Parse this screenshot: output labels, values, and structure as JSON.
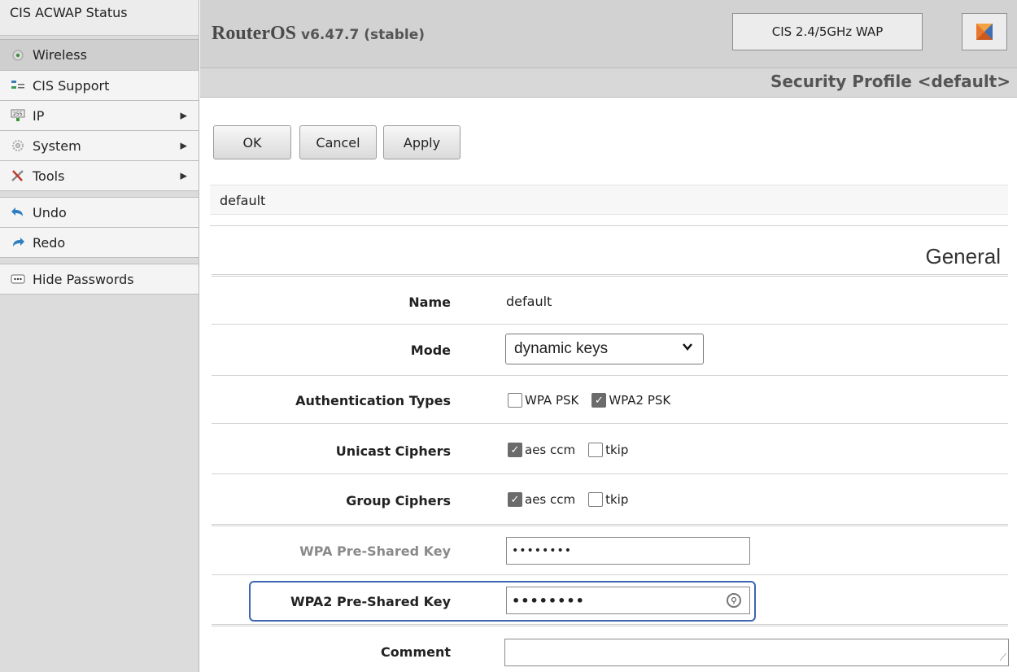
{
  "sidebar": {
    "title": "CIS ACWAP Status",
    "items": [
      {
        "label": "Wireless",
        "icon": "wireless-icon"
      },
      {
        "label": "CIS Support",
        "icon": "support-icon"
      },
      {
        "label": "IP",
        "icon": "ip-icon"
      },
      {
        "label": "System",
        "icon": "gear-icon"
      },
      {
        "label": "Tools",
        "icon": "tools-icon"
      },
      {
        "label": "Undo",
        "icon": "undo-icon"
      },
      {
        "label": "Redo",
        "icon": "redo-icon"
      },
      {
        "label": "Hide Passwords",
        "icon": "dots-icon"
      }
    ]
  },
  "header": {
    "product": "RouterOS",
    "version": "v6.47.7 (stable)",
    "device": "CIS 2.4/5GHz WAP",
    "page_title": "Security Profile <default>"
  },
  "toolbar": {
    "ok_label": "OK",
    "cancel_label": "Cancel",
    "apply_label": "Apply"
  },
  "profile_name_bar": "default",
  "section": "General",
  "form": {
    "name_label": "Name",
    "name_value": "default",
    "mode_label": "Mode",
    "mode_value": "dynamic keys",
    "auth_label": "Authentication Types",
    "auth_opts": [
      {
        "label": "WPA PSK",
        "checked": false
      },
      {
        "label": "WPA2 PSK",
        "checked": true
      }
    ],
    "unicast_label": "Unicast Ciphers",
    "unicast_opts": [
      {
        "label": "aes ccm",
        "checked": true
      },
      {
        "label": "tkip",
        "checked": false
      }
    ],
    "group_label": "Group Ciphers",
    "group_opts": [
      {
        "label": "aes ccm",
        "checked": true
      },
      {
        "label": "tkip",
        "checked": false
      }
    ],
    "wpa_psk_label": "WPA Pre-Shared Key",
    "wpa_psk_value": "••••••••",
    "wpa2_psk_label": "WPA2 Pre-Shared Key",
    "wpa2_psk_value": "••••••••",
    "comment_label": "Comment",
    "comment_value": ""
  },
  "colors": {
    "highlight": "#3d67b3",
    "sidebar_bg": "#dcdcdc",
    "header_bg": "#d2d2d2"
  }
}
